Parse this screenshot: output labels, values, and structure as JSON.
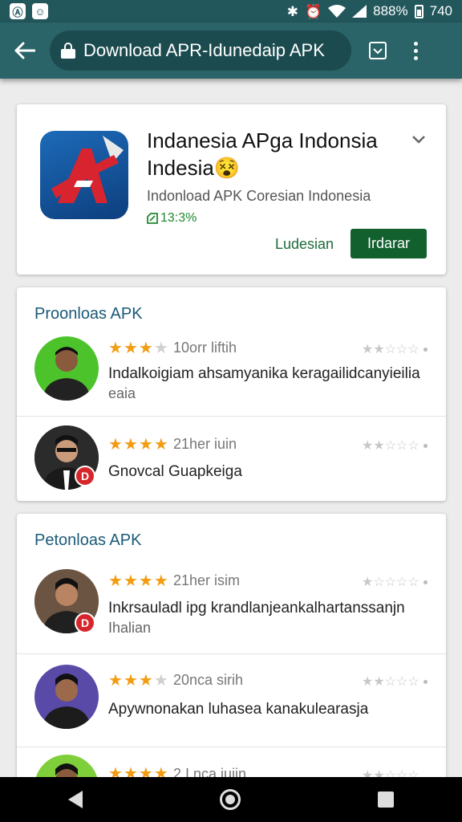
{
  "status_bar": {
    "app_icons": [
      "Ⓐ",
      "☺"
    ],
    "bluetooth": "✱",
    "alarm": "⏰",
    "battery_percent": "888%",
    "time": "740"
  },
  "browser": {
    "url": "Download APR-Idunedaip APK"
  },
  "app_card": {
    "title": "Indanesia APga Indonsia Indesia",
    "title_emoji": "😵",
    "subtitle": "Indonload APK  Coresian Indonesia",
    "size": "13:3%",
    "secondary_action": "Ludesian",
    "primary_action": "Irdarar"
  },
  "sections": [
    {
      "title": "Proonloas APK",
      "reviews": [
        {
          "stars": 3.5,
          "time": "10orr liftih",
          "text": "Indalkoigiam ahsamyanika keragailidcanyieilia",
          "text2": "eaia",
          "avatar_bg": "#4cc32b",
          "badge": ""
        },
        {
          "stars": 4,
          "time": "21her iuin",
          "text": "Gnovcal Guapkeiga",
          "text2": "",
          "avatar_bg": "#333333",
          "badge": "D"
        }
      ]
    },
    {
      "title": "Petonloas APK",
      "reviews": [
        {
          "stars": 4,
          "time": "21her isim",
          "text": "Inkrsauladl ipg krandlanjeankalhartanssanjn",
          "text2": "Ihalian",
          "avatar_bg": "#8a6b52",
          "badge": "D"
        },
        {
          "stars": 3,
          "time": "20nca sirih",
          "text": "Apywnonakan luhasea kanakulearasja",
          "text2": "",
          "avatar_bg": "#5a4aa8",
          "badge": ""
        },
        {
          "stars": 4.5,
          "time": "2 I nca iuiin",
          "text": "",
          "text2": "",
          "avatar_bg": "#7fcf3a",
          "badge": ""
        }
      ]
    }
  ],
  "colors": {
    "status_bar": "#22575c",
    "app_bar": "#2a6468",
    "primary_green": "#13602f",
    "section_title": "#1a5a78",
    "star": "#f39c12"
  },
  "icons": {
    "back": "arrow-left-icon",
    "lock": "lock-icon",
    "tabs": "tab-switcher-icon",
    "menu": "more-vert-icon",
    "expand": "chevron-down-icon"
  }
}
